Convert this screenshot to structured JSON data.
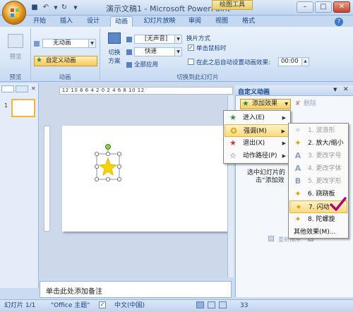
{
  "window": {
    "title": "演示文稿1 - Microsoft PowerPoint",
    "context_tab_group": "绘图工具"
  },
  "tabs": [
    "开始",
    "插入",
    "设计",
    "动画",
    "幻灯片放映",
    "审阅",
    "视图",
    "格式"
  ],
  "active_tab": "动画",
  "ribbon": {
    "preview": {
      "button": "预览",
      "group_label": "预览"
    },
    "animations": {
      "combo_value": "无动画",
      "custom_animation": "自定义动画",
      "group_label": "动画"
    },
    "transition": {
      "switch_scheme_line1": "切换",
      "switch_scheme_line2": "方案",
      "sound_value": "[无声音]",
      "speed_value": "快速",
      "apply_all": "全部应用",
      "advance_heading": "换片方式",
      "on_click": "单击鼠标时",
      "auto_after": "在此之后自动设置动画效果:",
      "auto_time": "00:00",
      "group_label": "切换到此幻灯片"
    }
  },
  "ruler": {
    "marks": "12 10 8 6 4 2 0 2 4 6 8 10 12"
  },
  "slide_pane": {
    "slide_number": "1"
  },
  "task_pane": {
    "title": "自定义动画",
    "add_effect": "添加效果",
    "delete": "删除",
    "hint_line1": "选中幻灯片的",
    "hint_line2": "击“添加效",
    "reorder": "重新排序"
  },
  "effect_menu": {
    "items": [
      "进入(E)",
      "强调(M)",
      "退出(X)",
      "动作路径(P)"
    ]
  },
  "emphasis_menu": {
    "items": [
      {
        "label": "1. 波浪形",
        "enabled": false
      },
      {
        "label": "2. 放大/缩小",
        "enabled": true
      },
      {
        "label": "3. 更改字号",
        "enabled": false
      },
      {
        "label": "4. 更改字体",
        "enabled": false
      },
      {
        "label": "5. 更改字形",
        "enabled": false
      },
      {
        "label": "6. 跷跷板",
        "enabled": true
      },
      {
        "label": "7. 闪动",
        "enabled": true
      },
      {
        "label": "8. 陀螺旋",
        "enabled": true
      },
      {
        "label": "其他效果(M)...",
        "enabled": true
      }
    ]
  },
  "notes": {
    "placeholder": "单击此处添加备注"
  },
  "statusbar": {
    "slide_info": "幻灯片 1/1",
    "theme": "\"Office 主题\"",
    "language": "中文(中国)",
    "zoom": "33"
  },
  "colors": {
    "checkmark": "#b0007a",
    "star_green": "#2e8b3e",
    "highlight": "#fbd97c"
  }
}
